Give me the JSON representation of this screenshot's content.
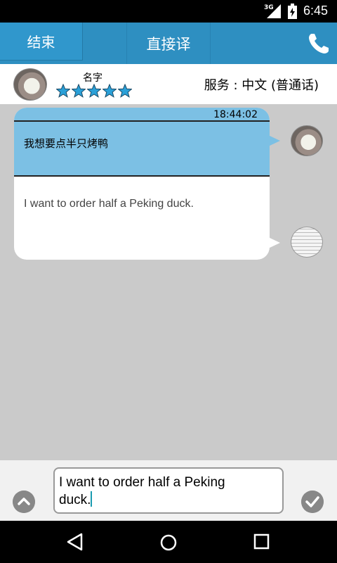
{
  "status_bar": {
    "network": "3G",
    "time": "6:45"
  },
  "header": {
    "end_label": "结束",
    "title": "直接译",
    "call_icon": "phone-icon"
  },
  "info_bar": {
    "name": "名字",
    "rating": 5,
    "rating_max": 5,
    "service": "服务 : 中文 (普通话)"
  },
  "chat": {
    "timestamp": "18:44:02",
    "source_text": "我想要点半只烤鸭",
    "translation_text": "I want to order half a Peking duck."
  },
  "input": {
    "value_line1": "I want to order half a Peking",
    "value_line2": "duck.",
    "expand_icon": "chevron-up-icon",
    "confirm_icon": "check-icon"
  },
  "colors": {
    "header": "#2e8fc1",
    "bubble_top": "#7cc0e4",
    "background": "#cacaca"
  }
}
